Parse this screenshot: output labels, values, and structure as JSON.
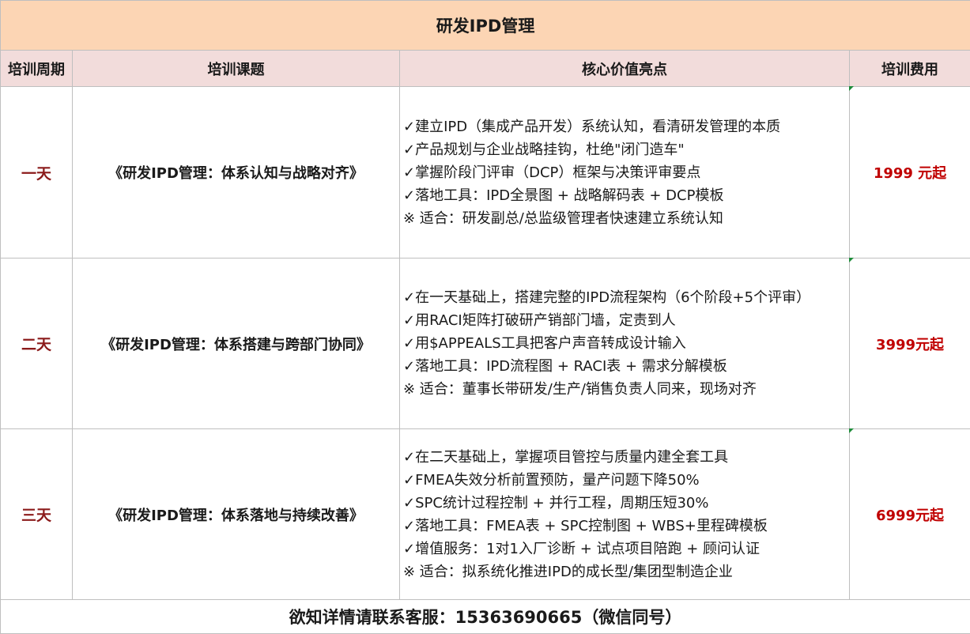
{
  "title": "研发IPD管理",
  "headers": [
    "培训周期",
    "培训课题",
    "核心价值亮点",
    "培训费用"
  ],
  "rows": [
    {
      "period": "一天",
      "topic": "《研发IPD管理：体系认知与战略对齐》",
      "points": [
        "✓建立IPD（集成产品开发）系统认知，看清研发管理的本质",
        "✓产品规划与企业战略挂钩，杜绝\"闭门造车\"",
        "✓掌握阶段门评审（DCP）框架与决策评审要点",
        "✓落地工具：IPD全景图 + 战略解码表 + DCP模板",
        "※ 适合：研发副总/总监级管理者快速建立系统认知"
      ],
      "fee": "1999 元起"
    },
    {
      "period": "二天",
      "topic": "《研发IPD管理：体系搭建与跨部门协同》",
      "points": [
        "✓在一天基础上，搭建完整的IPD流程架构（6个阶段+5个评审）",
        "✓用RACI矩阵打破研产销部门墙，定责到人",
        "✓用$APPEALS工具把客户声音转成设计输入",
        "✓落地工具：IPD流程图 + RACI表 + 需求分解模板",
        "※ 适合：董事长带研发/生产/销售负责人同来，现场对齐"
      ],
      "fee": "3999元起"
    },
    {
      "period": "三天",
      "topic": "《研发IPD管理：体系落地与持续改善》",
      "points": [
        "✓在二天基础上，掌握项目管控与质量内建全套工具",
        "✓FMEA失效分析前置预防，量产问题下降50%",
        "✓SPC统计过程控制 + 并行工程，周期压短30%",
        "✓落地工具：FMEA表 + SPC控制图 + WBS+里程碑模板",
        "✓增值服务：1对1入厂诊断 + 试点项目陪跑 + 顾问认证",
        "※ 适合：拟系统化推进IPD的成长型/集团型制造企业"
      ],
      "fee": "6999元起"
    }
  ],
  "footer": "欲知详情请联系客服：15363690665（微信同号）"
}
